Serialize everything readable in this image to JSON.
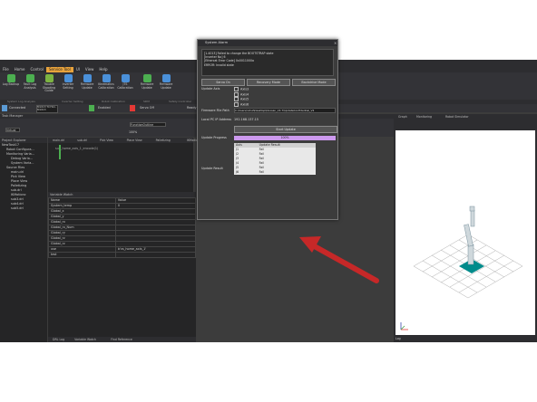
{
  "app": {
    "title": "DSRT Studio V1.0.0 Connected to Controller(192.168.137.100)"
  },
  "menu": [
    "File",
    "Home",
    "Control",
    "Service Tool",
    "UI",
    "View",
    "Help"
  ],
  "menu_active": "Service Tool",
  "ribbon": {
    "buttons": [
      {
        "label": "Log Backup",
        "color": "#4caf50"
      },
      {
        "label": "Fault Log Analysis",
        "color": "#4caf50"
      },
      {
        "label": "Trouble Shooting Guide",
        "color": "#7cb342"
      },
      {
        "label": "Inverter Setting",
        "color": "#4a90d9"
      },
      {
        "label": "Firmware Update",
        "color": "#4a90d9"
      },
      {
        "label": "Kinematics Calibration",
        "color": "#4a90d9"
      },
      {
        "label": "JTS Calibration",
        "color": "#4a90d9"
      },
      {
        "label": "Firmware Update",
        "color": "#4caf50"
      },
      {
        "label": "Firmware Update",
        "color": "#4a90d9"
      }
    ],
    "groups": [
      "System Log Analysis",
      "Inverter Setting",
      "Robot Calibration",
      "SDM",
      "Safety Controller"
    ]
  },
  "toolbar": {
    "connection": "Connected",
    "model": "M1013 TCYSO-M1013",
    "servo": "Enabled",
    "servo_state": "Servo Off",
    "ready": "Ready",
    "mode": "Real"
  },
  "task_manager": {
    "title": "Task Manager",
    "mode": "Virtual",
    "zoom": "100%",
    "tabs": [
      "main.drl",
      "sub.drl",
      "Pick View",
      "Place View",
      "Palletizing",
      "IKMotionc"
    ],
    "function_outline": "FunctionOutline",
    "code": "sub_home_axis_1_encode(1)"
  },
  "explorer": {
    "title": "Project Explorer",
    "items": [
      {
        "label": "NewTask17",
        "depth": 0
      },
      {
        "label": "Robot Configura...",
        "depth": 1
      },
      {
        "label": "Monitoring Varia...",
        "depth": 1
      },
      {
        "label": "Debug Varia...",
        "depth": 2
      },
      {
        "label": "System Varia...",
        "depth": 2
      },
      {
        "label": "Source Files",
        "depth": 1
      },
      {
        "label": "main.drl",
        "depth": 2
      },
      {
        "label": "Pick View",
        "depth": 2
      },
      {
        "label": "Place View",
        "depth": 2
      },
      {
        "label": "Palletizing",
        "depth": 2
      },
      {
        "label": "sub.drl",
        "depth": 2
      },
      {
        "label": "IKMotionc",
        "depth": 2
      },
      {
        "label": "sub3.drl",
        "depth": 2
      },
      {
        "label": "sub4.drl",
        "depth": 2
      },
      {
        "label": "sub5.drl",
        "depth": 2
      }
    ]
  },
  "variable_watch": {
    "title": "Variable Watch",
    "headers": [
      "Name",
      "Value"
    ],
    "rows": [
      [
        "System_temp",
        "0"
      ],
      [
        "Global_x",
        ""
      ],
      [
        "Global_y",
        ""
      ],
      [
        "Global_rx",
        ""
      ],
      [
        "Global_rx_Num",
        ""
      ],
      [
        "Global_ry",
        ""
      ],
      [
        "Global_rz",
        ""
      ],
      [
        "Global_rz",
        ""
      ],
      [
        "use",
        "b'vs_home_axis_1'"
      ],
      [
        "test",
        ""
      ]
    ],
    "bottom_tabs": [
      "DRL Log",
      "Variable Watch",
      "Find Reference"
    ]
  },
  "view3d": {
    "tabs": [
      "Graph",
      "Monitoring",
      "Robot Simulator"
    ],
    "log_label": "Log"
  },
  "dialog": {
    "title": "System Alarm",
    "message_lines": [
      "[1.4013] Failed to change the BOOTSTRAP state",
      "[Inverter No] 6",
      "[Ethercat Error Code] 0x0011000a",
      "ERROR: Invalid state"
    ],
    "buttons": [
      "Servo On",
      "Recovery Mode",
      "Backdrive Mode"
    ],
    "update_axis_label": "Update Axis",
    "axes": [
      "Axis3",
      "Axis4",
      "Axis5",
      "Axis6"
    ],
    "firmware_label": "Firmware File Path",
    "firmware_path": "C:\\Users\\rahul\\Desktop\\Doosan_V2.7\\UpdateConfidential_V2",
    "ip_label": "Local PC IP Address",
    "ip_value": "192.168.137.15",
    "start_label": "Start Update",
    "progress_label": "Update Progress",
    "progress_text": "100%",
    "progress": 1.0,
    "result_label": "Update Result",
    "result_headers": [
      "Axis",
      "Update Result"
    ],
    "results": [
      [
        "J1",
        "Fail"
      ],
      [
        "J2",
        "Fail"
      ],
      [
        "J3",
        "Fail"
      ],
      [
        "J4",
        "Fail"
      ],
      [
        "J5",
        "Fail"
      ],
      [
        "J6",
        "Fail"
      ]
    ]
  },
  "colors": {
    "accent": "#e8a33c",
    "arrow": "#c62828",
    "progress": "#cc99ee",
    "floor": "#008b8b"
  }
}
